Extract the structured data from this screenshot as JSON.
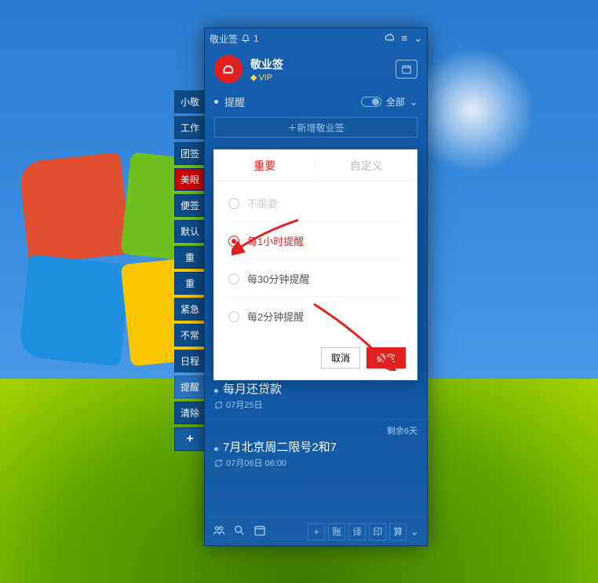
{
  "wallpaper": {
    "os": "Windows 7"
  },
  "sidebar_tabs": {
    "items": [
      {
        "label": "小敬",
        "key": "xiaojing"
      },
      {
        "label": "工作",
        "key": "work"
      },
      {
        "label": "团签",
        "key": "team"
      },
      {
        "label": "美眼",
        "key": "beauty",
        "highlight": true
      },
      {
        "label": "便签",
        "key": "note"
      },
      {
        "label": "默认",
        "key": "default"
      },
      {
        "label": "重",
        "key": "imp1"
      },
      {
        "label": "重",
        "key": "imp2"
      },
      {
        "label": "紧急",
        "key": "urgent"
      },
      {
        "label": "不常",
        "key": "rare"
      },
      {
        "label": "日程",
        "key": "schedule"
      },
      {
        "label": "提醒",
        "key": "remind",
        "active": true
      },
      {
        "label": "清除",
        "key": "clear"
      }
    ],
    "plus": "+"
  },
  "app": {
    "titlebar": {
      "name": "敬业签",
      "bell_icon": "bell-icon",
      "notif_count": "1"
    },
    "name": "敬业签",
    "vip": "VIP",
    "section": {
      "label": "提醒",
      "filter": "全部"
    },
    "add_button": "＋新增敬业签",
    "items": [
      {
        "title": "每月还贷款",
        "date_line": "07月25日",
        "remaining": ""
      },
      {
        "title": "7月北京周二限号2和7",
        "date_line": "07月06日 06:00",
        "remaining": "剩余6天"
      }
    ],
    "bottombar": {
      "icons": [
        "people-icon",
        "search-icon",
        "calendar-icon"
      ],
      "buttons": [
        "+",
        "账",
        "译",
        "印",
        "算"
      ]
    }
  },
  "modal": {
    "tabs": {
      "important": "重要",
      "custom": "自定义"
    },
    "options": {
      "not_important": "不重要",
      "hourly": "每1小时提醒",
      "thirty": "每30分钟提醒",
      "two": "每2分钟提醒"
    },
    "selected": "hourly",
    "cancel": "取消",
    "confirm": "确定"
  }
}
